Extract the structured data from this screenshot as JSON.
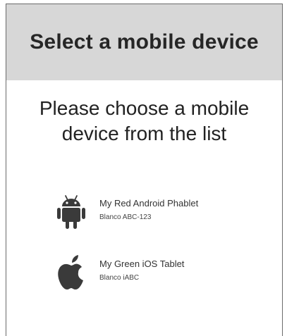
{
  "header": {
    "title": "Select a mobile device"
  },
  "main": {
    "prompt": "Please choose a mobile device from the list",
    "devices": [
      {
        "name": "My Red Android Phablet",
        "subtitle": "Blanco ABC-123",
        "icon": "android-icon"
      },
      {
        "name": "My Green iOS Tablet",
        "subtitle": "Blanco iABC",
        "icon": "apple-icon"
      }
    ]
  },
  "colors": {
    "header_bg": "#d7d7d7",
    "icon": "#3a3a3a",
    "text": "#222222"
  }
}
